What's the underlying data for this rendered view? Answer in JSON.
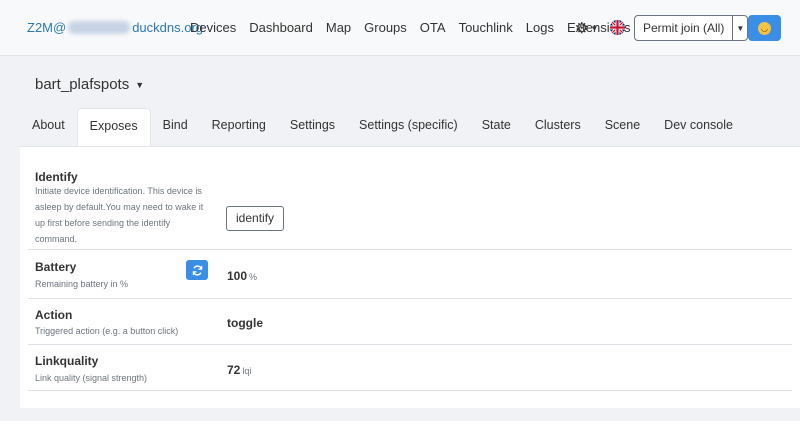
{
  "navbar": {
    "brand_prefix": "Z2M@",
    "brand_suffix": "duckdns.org",
    "links": [
      "Devices",
      "Dashboard",
      "Map",
      "Groups",
      "OTA",
      "Touchlink",
      "Logs",
      "Extensions"
    ],
    "permit_join_label": "Permit join (All)"
  },
  "device": {
    "name": "bart_plafspots"
  },
  "tabs": [
    "About",
    "Exposes",
    "Bind",
    "Reporting",
    "Settings",
    "Settings (specific)",
    "State",
    "Clusters",
    "Scene",
    "Dev console"
  ],
  "active_tab": "Exposes",
  "exposes": {
    "identify": {
      "title": "Identify",
      "desc": "Initiate device identification. This device is asleep by default.You may need to wake it up first before sending the identify command.",
      "button": "identify"
    },
    "battery": {
      "title": "Battery",
      "desc": "Remaining battery in %",
      "value": "100",
      "unit": "%"
    },
    "action": {
      "title": "Action",
      "desc": "Triggered action (e.g. a button click)",
      "value": "toggle"
    },
    "linkquality": {
      "title": "Linkquality",
      "desc": "Link quality (signal strength)",
      "value": "72",
      "unit": "lqi"
    }
  },
  "colors": {
    "accent": "#3a8ee6",
    "brand_link": "#2a7ab0"
  },
  "icons": {
    "settings": "gear-icon",
    "language": "uk-flag-icon",
    "theme": "smile-icon",
    "refresh": "refresh-icon"
  }
}
